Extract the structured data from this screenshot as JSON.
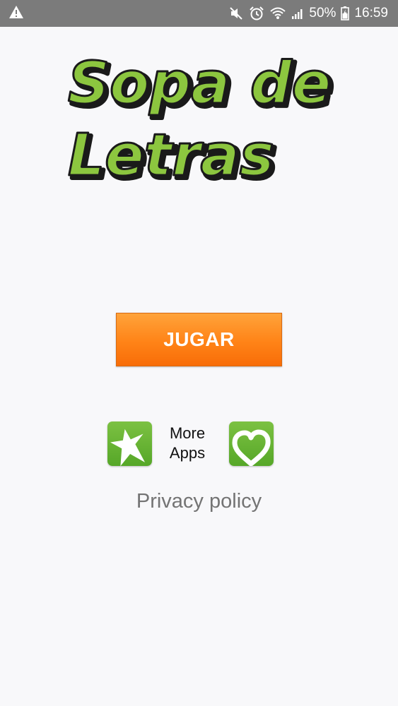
{
  "status_bar": {
    "battery": "50%",
    "time": "16:59",
    "icons": [
      "warning-icon",
      "mute-icon",
      "alarm-icon",
      "wifi-icon",
      "signal-icon",
      "battery-icon"
    ]
  },
  "logo": {
    "line1": "Sopa de",
    "line2": "Letras",
    "fill_color": "#8cc63f",
    "outline_color": "#1a1a1a"
  },
  "play_button": {
    "label": "JUGAR",
    "color": "#ff8a1e"
  },
  "more_apps": {
    "label_line1": "More",
    "label_line2": "Apps",
    "left_icon": "star-icon",
    "right_icon": "heart-icon",
    "icon_color": "#6bb535"
  },
  "privacy_link": {
    "label": "Privacy policy"
  }
}
